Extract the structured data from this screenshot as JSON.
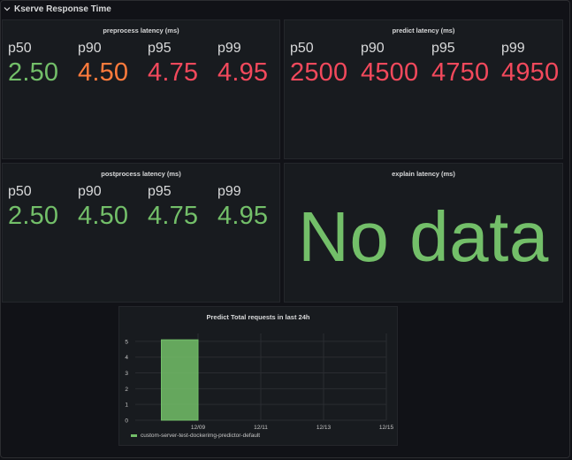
{
  "row": {
    "title": "Kserve Response Time"
  },
  "panels": {
    "preprocess": {
      "title": "preprocess latency (ms)",
      "stats": [
        {
          "label": "p50",
          "value": "2.50",
          "color": "#73bf69"
        },
        {
          "label": "p90",
          "value": "4.50",
          "color": "#ff7b3c"
        },
        {
          "label": "p95",
          "value": "4.75",
          "color": "#f2495c"
        },
        {
          "label": "p99",
          "value": "4.95",
          "color": "#f2495c"
        }
      ]
    },
    "predict": {
      "title": "predict latency (ms)",
      "stats": [
        {
          "label": "p50",
          "value": "2500",
          "color": "#f2495c"
        },
        {
          "label": "p90",
          "value": "4500",
          "color": "#f2495c"
        },
        {
          "label": "p95",
          "value": "4750",
          "color": "#f2495c"
        },
        {
          "label": "p99",
          "value": "4950",
          "color": "#f2495c"
        }
      ]
    },
    "postprocess": {
      "title": "postprocess latency (ms)",
      "stats": [
        {
          "label": "p50",
          "value": "2.50",
          "color": "#73bf69"
        },
        {
          "label": "p90",
          "value": "4.50",
          "color": "#73bf69"
        },
        {
          "label": "p95",
          "value": "4.75",
          "color": "#73bf69"
        },
        {
          "label": "p99",
          "value": "4.95",
          "color": "#73bf69"
        }
      ]
    },
    "explain": {
      "title": "explain latency (ms)",
      "message": "No data",
      "message_color": "#73bf69"
    },
    "requests": {
      "title": "Predict Total requests in last 24h",
      "legend": "custom-server-test-dockerimg-predictor-default"
    }
  },
  "chart_data": {
    "type": "bar",
    "title": "Predict Total requests in last 24h",
    "x_ticks": [
      "12/09",
      "12/11",
      "12/13",
      "12/15"
    ],
    "y_ticks": [
      0,
      1,
      2,
      3,
      4,
      5
    ],
    "ylim": [
      0,
      5.5
    ],
    "series": [
      {
        "name": "custom-server-test-dockerimg-predictor-default",
        "color": "#73bf69",
        "bars": [
          {
            "x_start": "12/08",
            "x_end": "12/09",
            "value": 5.1
          }
        ]
      }
    ],
    "grid": true,
    "legend_position": "bottom-left"
  }
}
